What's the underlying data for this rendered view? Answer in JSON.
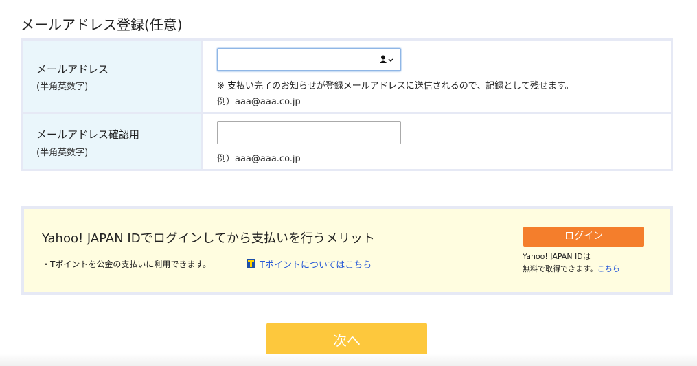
{
  "section": {
    "title": "メールアドレス登録(任意)"
  },
  "email": {
    "label": "メールアドレス",
    "sub_label": "(半角英数字)",
    "value": "",
    "note": "※ 支払い完了のお知らせが登録メールアドレスに送信されるので、記録として残せます。",
    "example": "例）aaa@aaa.co.jp",
    "autofill_icon": "contact-autofill-icon"
  },
  "email_confirm": {
    "label": "メールアドレス確認用",
    "sub_label": "(半角英数字)",
    "value": "",
    "example": "例）aaa@aaa.co.jp"
  },
  "yahoo": {
    "title": "Yahoo! JAPAN IDでログインしてから支払いを行うメリット",
    "bullet": "・Tポイントを公金の支払いに利用できます。",
    "tpoint_icon": "t-point-icon",
    "tpoint_link": "Tポイントについてはこちら",
    "login_button": "ログイン",
    "id_note_line1": "Yahoo! JAPAN IDは",
    "id_note_line2": "無料で取得できます。",
    "id_note_link": "こちら"
  },
  "next_button": "次へ",
  "colors": {
    "login_button": "#f47e2c",
    "next_button": "#fdc83d",
    "label_background": "#eaf6fb",
    "yahoo_background": "#fffde0",
    "link": "#2a5bd7"
  }
}
